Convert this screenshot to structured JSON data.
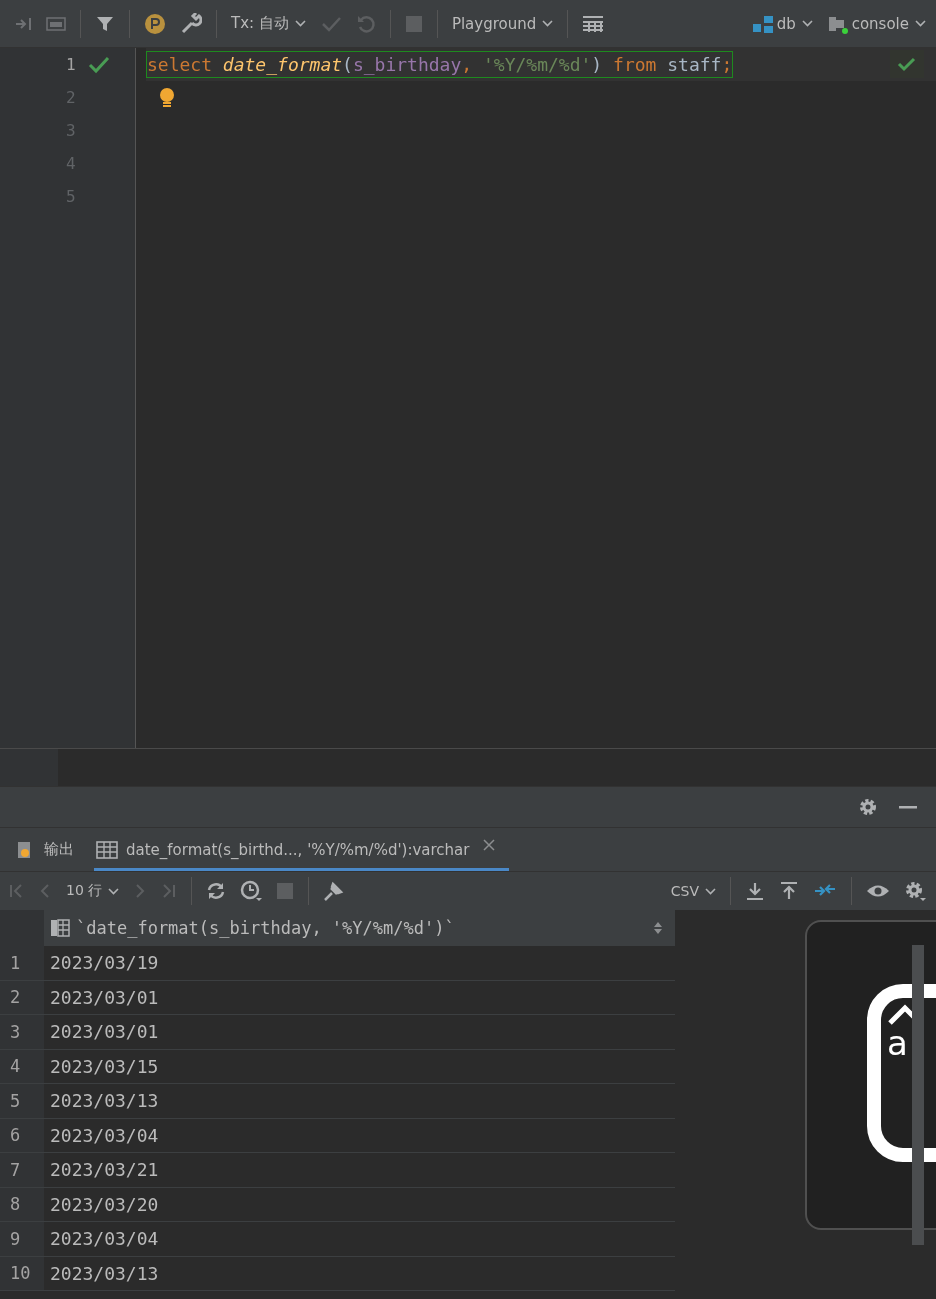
{
  "toolbar": {
    "tx_label": "Tx: 自动",
    "playground": "Playground",
    "datasource": "db",
    "console": "console"
  },
  "editor": {
    "lines": [
      {
        "number": "1",
        "status_ok": true,
        "tokens": [
          {
            "kind": "keyword",
            "text": "select "
          },
          {
            "kind": "function",
            "text": "date_format"
          },
          {
            "kind": "plain",
            "text": "("
          },
          {
            "kind": "param",
            "text": "s_birthday"
          },
          {
            "kind": "punct",
            "text": ", "
          },
          {
            "kind": "string",
            "text": "'%Y/%m/%d'"
          },
          {
            "kind": "plain",
            "text": ")"
          },
          {
            "kind": "keyword",
            "text": " from "
          },
          {
            "kind": "plain",
            "text": "staff"
          },
          {
            "kind": "punct",
            "text": ";"
          }
        ]
      },
      {
        "number": "2",
        "status_ok": false
      },
      {
        "number": "3",
        "status_ok": false
      },
      {
        "number": "4",
        "status_ok": false
      },
      {
        "number": "5",
        "status_ok": false
      }
    ]
  },
  "results": {
    "tabs": [
      {
        "kind": "output",
        "label": "输出",
        "selected": false,
        "closable": false
      },
      {
        "kind": "table",
        "label": "date_format(s_birthd..., '%Y/%m/%d'):varchar",
        "selected": true,
        "closable": true
      }
    ],
    "page_size": "10 行",
    "export_format": "CSV",
    "column": "`date_format(s_birthday, '%Y/%m/%d')`",
    "rows": [
      {
        "n": "1",
        "value": "2023/03/19"
      },
      {
        "n": "2",
        "value": "2023/03/01"
      },
      {
        "n": "3",
        "value": "2023/03/01"
      },
      {
        "n": "4",
        "value": "2023/03/15"
      },
      {
        "n": "5",
        "value": "2023/03/13"
      },
      {
        "n": "6",
        "value": "2023/03/04"
      },
      {
        "n": "7",
        "value": "2023/03/21"
      },
      {
        "n": "8",
        "value": "2023/03/20"
      },
      {
        "n": "9",
        "value": "2023/03/04"
      },
      {
        "n": "10",
        "value": "2023/03/13"
      }
    ]
  },
  "key_overlay": {
    "key": "a"
  }
}
